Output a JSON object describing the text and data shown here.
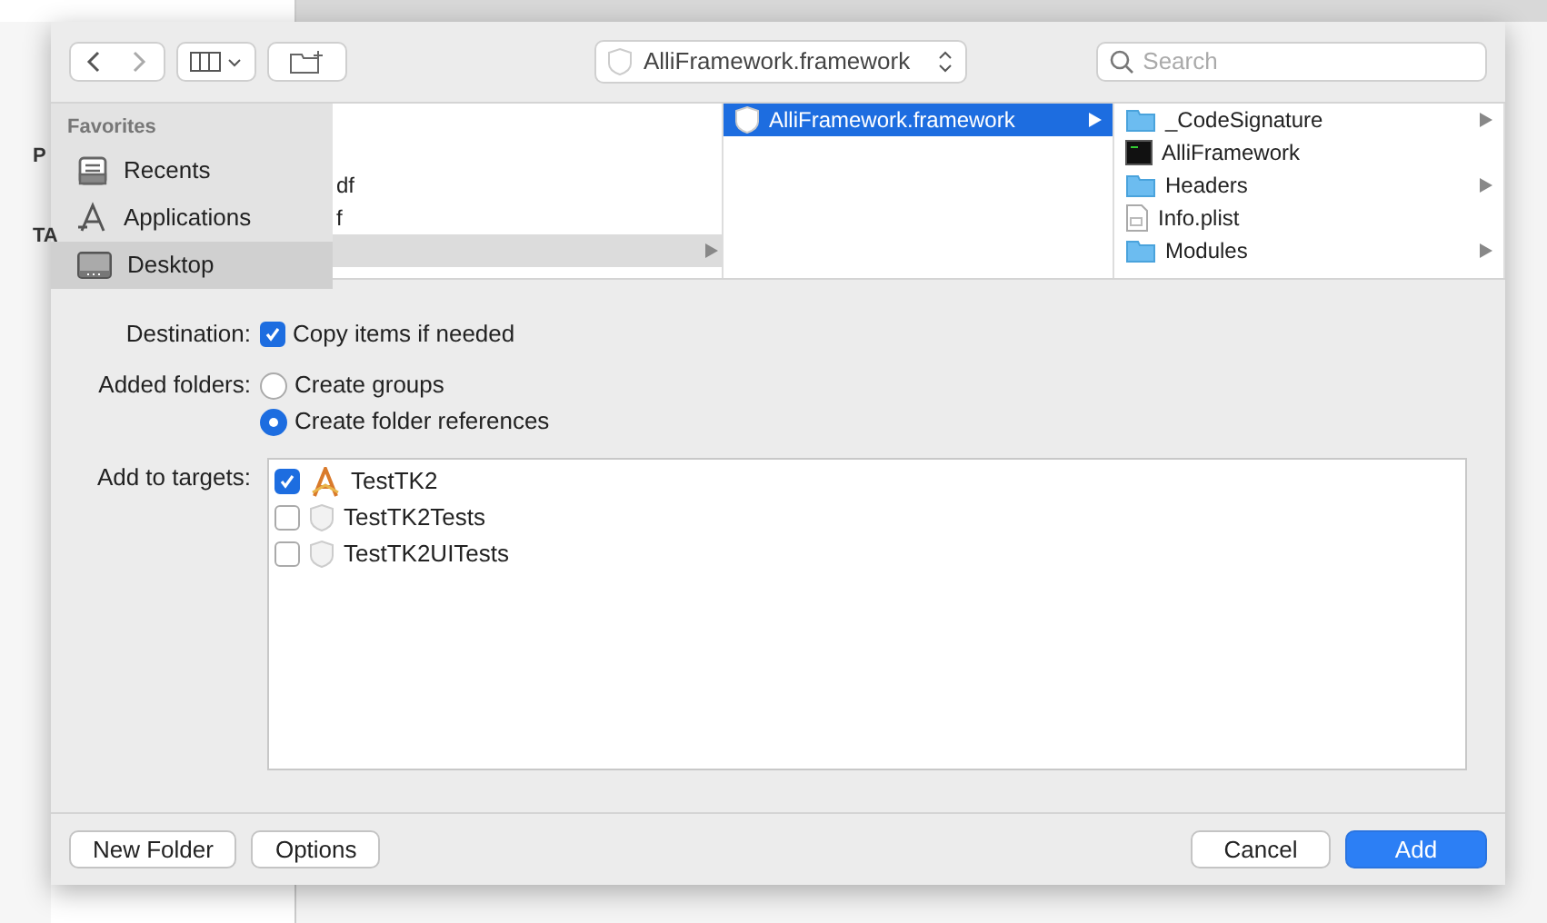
{
  "background": {
    "labels": [
      "P",
      "TA"
    ]
  },
  "toolbar": {
    "path_popup": "AlliFramework.framework",
    "search": {
      "placeholder": "Search"
    }
  },
  "sidebar": {
    "header": "Favorites",
    "items": [
      {
        "label": "Recents",
        "kind": "recents",
        "selected": false
      },
      {
        "label": "Applications",
        "kind": "applications",
        "selected": false
      },
      {
        "label": "Desktop",
        "kind": "desktop",
        "selected": true
      }
    ]
  },
  "columns": [
    {
      "items": [
        {
          "label": "df",
          "selected": false,
          "has_children": false
        },
        {
          "label": "f",
          "selected": false,
          "has_children": false
        },
        {
          "selected": true,
          "has_children": true
        }
      ]
    },
    {
      "items": [
        {
          "label": "AlliFramework.framework",
          "kind": "framework",
          "selected": true,
          "has_children": true
        }
      ]
    },
    {
      "items": [
        {
          "label": "_CodeSignature",
          "kind": "folder",
          "selected": false,
          "has_children": true
        },
        {
          "label": "AlliFramework",
          "kind": "executable",
          "selected": false,
          "has_children": false
        },
        {
          "label": "Headers",
          "kind": "folder",
          "selected": false,
          "has_children": true
        },
        {
          "label": "Info.plist",
          "kind": "plist",
          "selected": false,
          "has_children": false
        },
        {
          "label": "Modules",
          "kind": "folder",
          "selected": false,
          "has_children": true
        }
      ]
    }
  ],
  "destination": {
    "label": "Destination:",
    "option": {
      "label": "Copy items if needed",
      "checked": true
    }
  },
  "added_folders": {
    "label": "Added folders:",
    "options": [
      {
        "label": "Create groups",
        "selected": false
      },
      {
        "label": "Create folder references",
        "selected": true
      }
    ]
  },
  "targets": {
    "label": "Add to targets:",
    "items": [
      {
        "label": "TestTK2",
        "kind": "app",
        "checked": true
      },
      {
        "label": "TestTK2Tests",
        "kind": "test",
        "checked": false
      },
      {
        "label": "TestTK2UITests",
        "kind": "test",
        "checked": false
      }
    ]
  },
  "footer": {
    "left_buttons": [
      "New Folder",
      "Options"
    ],
    "right_buttons": [
      {
        "label": "Cancel",
        "kind": "default"
      },
      {
        "label": "Add",
        "kind": "primary"
      }
    ]
  }
}
